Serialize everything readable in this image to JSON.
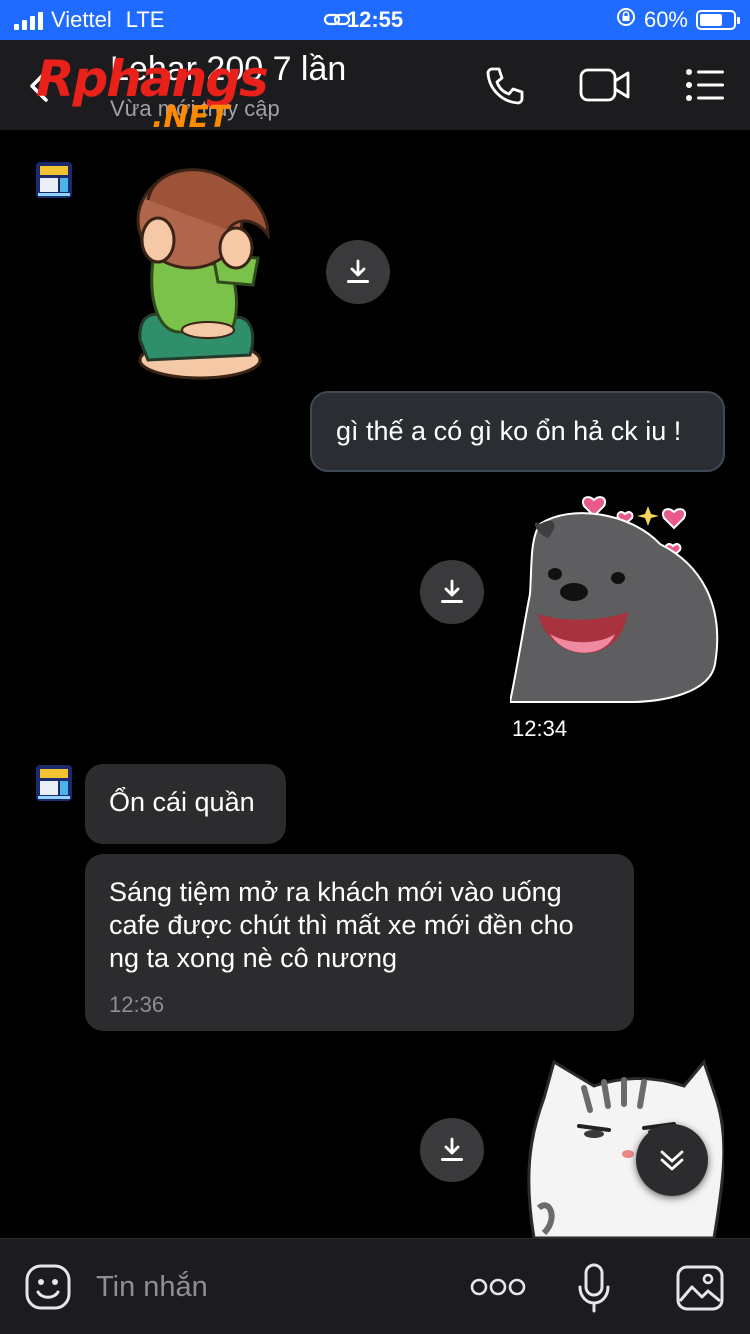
{
  "status": {
    "carrier": "Viettel",
    "network": "LTE",
    "time": "12:55",
    "battery": "60%"
  },
  "header": {
    "title": "Lehar 200 7 lần",
    "subtitle": "Vừa mới truy cập",
    "watermark": "Rphangs",
    "watermark_suffix": ".NET",
    "icons": [
      "back-icon",
      "phone-icon",
      "video-icon",
      "menu-icon"
    ]
  },
  "messages": {
    "m1_text": "gì thế a có gì ko ổn hả ck iu !",
    "m2_time": "12:34",
    "m3_text": "Ổn cái quần",
    "m4_text": "Sáng tiệm mở ra khách mới vào uống cafe được chút thì mất xe mới đền cho ng ta xong nè cô nương",
    "m4_time": "12:36"
  },
  "composer": {
    "placeholder": "Tin nhắn",
    "icons": [
      "emoji-icon",
      "more-icon",
      "microphone-icon",
      "image-icon"
    ]
  },
  "colors": {
    "status_bar": "#1f6bff",
    "header": "#1c1c1e",
    "incoming_bubble": "#2c2c2e",
    "outgoing_bubble": "#2a2e33"
  }
}
